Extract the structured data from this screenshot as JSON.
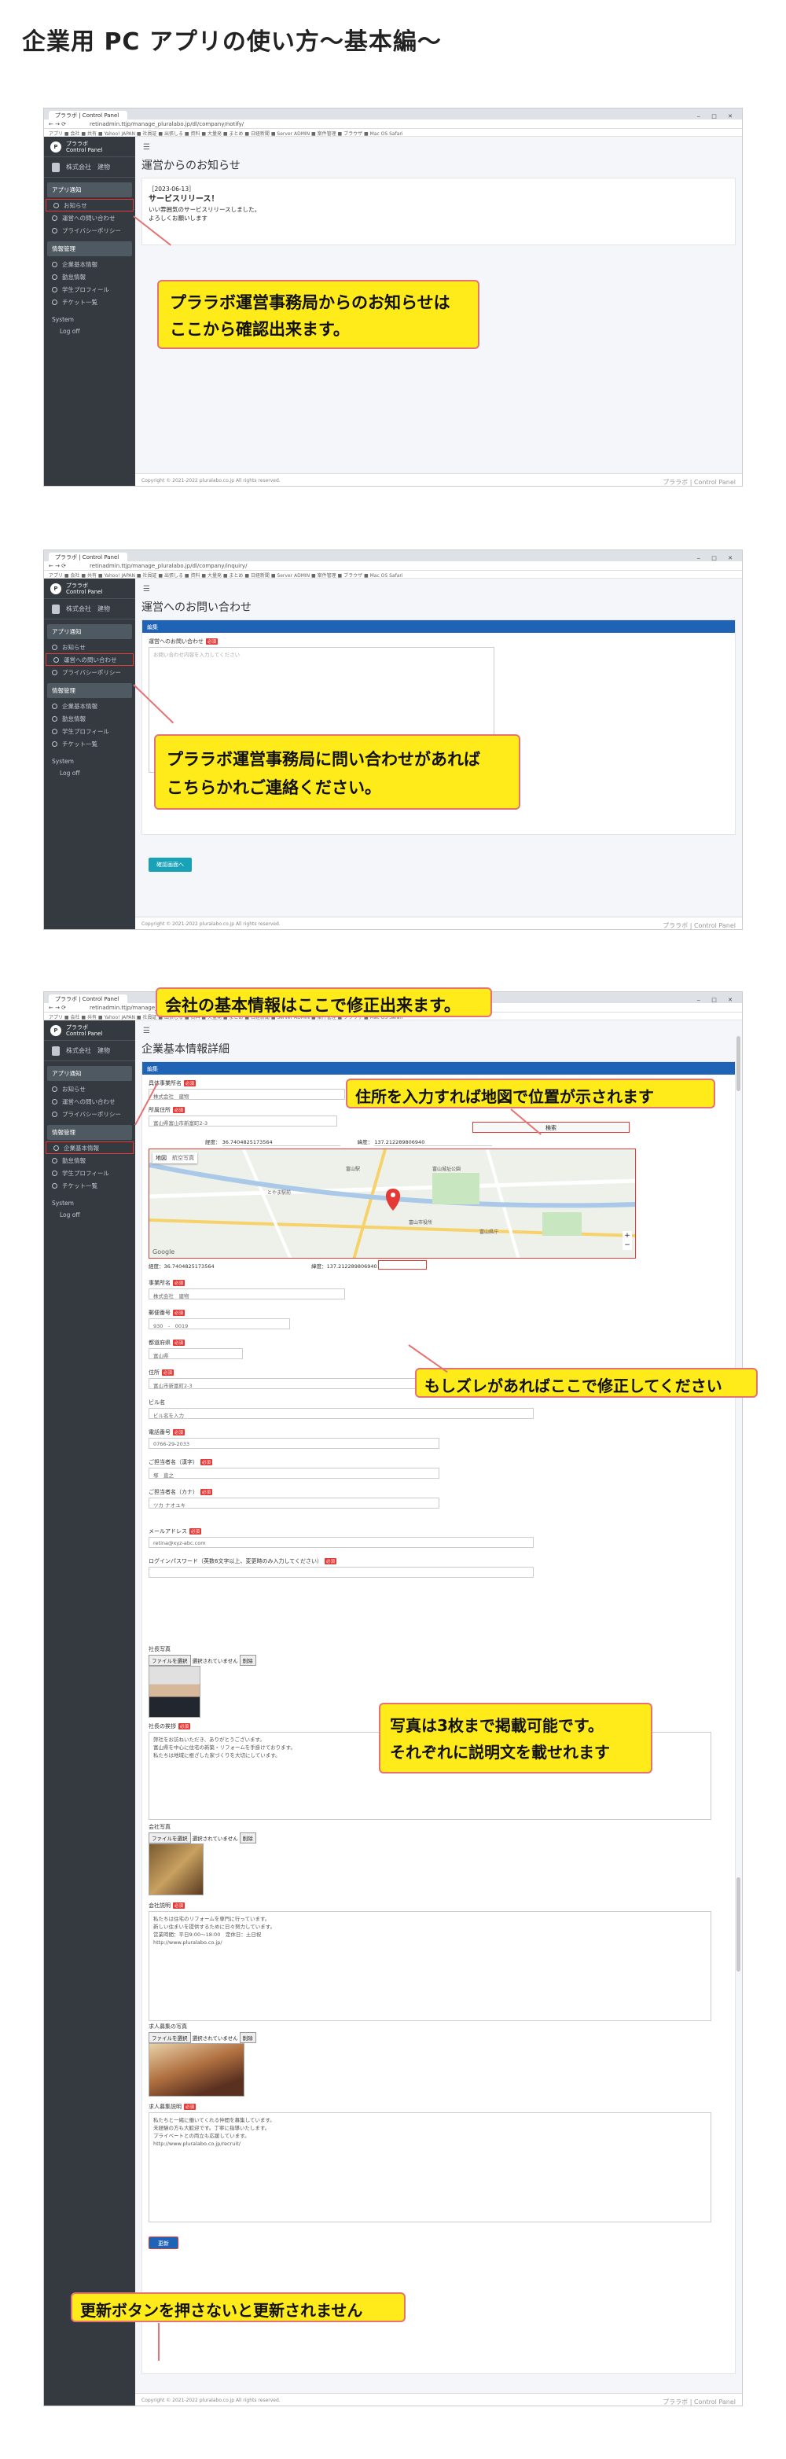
{
  "page_title": "企業用 PC アプリの使い方～基本編～",
  "browser": {
    "tab_label": "プララボ | Control Panel",
    "window_controls": "‒ □ ✕",
    "urls": [
      "retinadmin.ttjp/manage_pluralabo.jp/dl/company/notify/",
      "retinadmin.ttjp/manage_pluralabo.jp/dl/company/inquiry/",
      "retinadmin.ttjp/manage_pluralabo.jp/dl/company/edit/"
    ],
    "bookmarks": "アプリ  ■ 会社  ■ 共有  ■ Yahoo! JAPAN  ■ 社員証  ■ 出張しる  ■ 資料  ■ 大量発  ■ まとめ  ■ 日経新聞  ■ Server ADMIN  ■ 案件管理  ■ ブラウザ  ■ Mac OS Safari"
  },
  "sidebar": {
    "brand_line1": "プララボ",
    "brand_line2": "Control Panel",
    "user": "株式会社　建物",
    "section_app": "アプリ通知",
    "items_app": [
      "お知らせ",
      "運営への問い合わせ",
      "プライバシーポリシー"
    ],
    "section_info": "情報管理",
    "items_info": [
      "企業基本情報",
      "勤怠情報",
      "学生プロフィール",
      "チケット一覧"
    ],
    "system": "System",
    "logoff": "Log off"
  },
  "footer": {
    "copyright": "Copyright © 2021-2022 pluralabo.co.jp  All rights reserved.",
    "brand": "プララボ | Control Panel"
  },
  "screen1": {
    "title": "運営からのお知らせ",
    "date": "［2023-06-13］",
    "heading": "サービスリリース！",
    "body1": "いい雰囲気のサービスリリースしました。",
    "body2": "よろしくお願いします",
    "callout": "プララボ運営事務局からのお知らせは\nここから確認出来ます。"
  },
  "screen2": {
    "title": "運営へのお問い合わせ",
    "card_head": "編集",
    "field_label": "運営へのお問い合わせ",
    "required": "必須",
    "placeholder": "お問い合わせ内容を入力してください",
    "button": "確認画面へ",
    "callout": "プララボ運営事務局に問い合わせがあれば\nこちらかれご連絡ください。"
  },
  "screen3": {
    "title": "企業基本情報詳細",
    "card_head": "編集",
    "required": "必須",
    "company_label": "具体事業所名",
    "company_value": "株式会社　建物",
    "address_label": "所属住所",
    "address_value": "富山県富山市新富町2-3",
    "search_button": "検索",
    "lat_label": "経度：",
    "lat_value": "36.7404825173564",
    "lng_label": "緯度：",
    "lng_value": "137.212289806940",
    "map_tabs": [
      "地図",
      "航空写真"
    ],
    "map_labels": [
      "富山駅",
      "富山市役所",
      "富山城址公園",
      "とやま駅前",
      "富山県庁",
      "Google"
    ],
    "coords_line": "経度：36.7404825173564　　　　　　　　　　　　　　　　　　　緯度：137.212289806940",
    "fields": [
      {
        "label": "事業所名",
        "value": "株式会社　建物",
        "req": true
      },
      {
        "label": "郵便番号",
        "value": "930　-　0019",
        "req": true
      },
      {
        "label": "都道府県",
        "value": "富山県",
        "req": true
      },
      {
        "label": "住所",
        "value": "富山市新富町2-3",
        "req": true
      },
      {
        "label": "ビル名",
        "value": "ビル名を入力",
        "req": false
      },
      {
        "label": "電話番号",
        "value": "0766-29-2033",
        "req": true
      },
      {
        "label": "ご担当者名（漢字）",
        "value": "塚　直之",
        "req": true
      },
      {
        "label": "ご担当者名（カナ）",
        "value": "ツカ ナオユキ",
        "req": true
      },
      {
        "label": "メールアドレス",
        "value": "retina@xyz-abc.com",
        "req": true
      },
      {
        "label": "ログインパスワード（英数6文字以上、変更時のみ入力してください）",
        "value": "",
        "req": true
      }
    ],
    "photo_label": "社長写真",
    "file_button": "ファイルを選択",
    "file_none": "選択されていません",
    "delete": "削除",
    "desc1_label": "社長の挨拶",
    "desc1": "弊社をお訪ねいただき、ありがとうございます。\n富山県を中心に住宅の新築・リフォームを手掛けております。\n私たちは地域に根ざした家づくりを大切にしています。",
    "photo2_label": "会社写真",
    "desc2_label": "会社説明",
    "desc2": "私たちは住宅のリフォームを専門に行っています。\n新しい住まいを提供するために日々努力しています。\n営業時間：平日9:00〜18:00　定休日：土日祝\nhttp://www.pluralabo.co.jp/",
    "photo3_label": "求人募集の写真",
    "desc3_label": "求人募集説明",
    "desc3": "私たちと一緒に働いてくれる仲間を募集しています。\n未経験の方も大歓迎です。丁寧に指導いたします。\nプライベートとの両立も応援しています。\nhttp://www.pluralabo.co.jp/recruit/",
    "update_button": "更新",
    "callouts": {
      "basic": "会社の基本情報はここで修正出来ます。",
      "map": "住所を入力すれば地図で位置が示されます",
      "fix": "もしズレがあればここで修正してください",
      "photo": "写真は3枚まで掲載可能です。\nそれぞれに説明文を載せれます",
      "update": "更新ボタンを押さないと更新されません"
    }
  }
}
